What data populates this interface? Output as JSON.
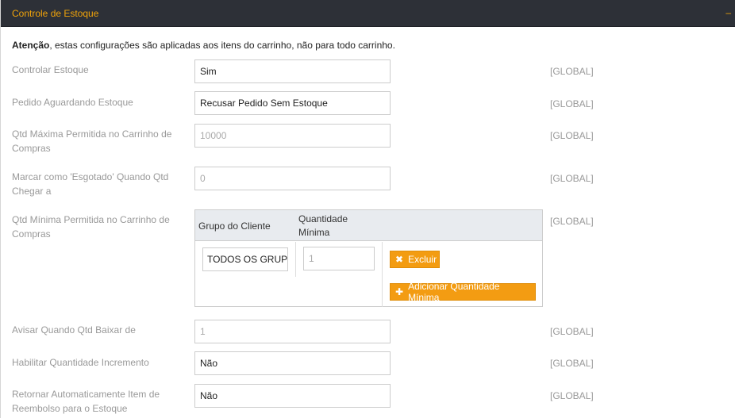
{
  "panel": {
    "title": "Controle de Estoque",
    "collapse_symbol": "–"
  },
  "notice": {
    "bold": "Atenção",
    "text": ", estas configurações são aplicadas aos itens do carrinho, não para todo carrinho."
  },
  "fields": {
    "controlar_estoque": {
      "label": "Controlar Estoque",
      "value": "Sim",
      "scope": "[GLOBAL]"
    },
    "pedido_aguardando": {
      "label": "Pedido Aguardando Estoque",
      "value": "Recusar Pedido Sem Estoque",
      "scope": "[GLOBAL]"
    },
    "qtd_maxima": {
      "label": "Qtd Máxima Permitida no Carrinho de Compras",
      "value": "10000",
      "scope": "[GLOBAL]"
    },
    "marcar_esgotado": {
      "label": "Marcar como 'Esgotado' Quando Qtd Chegar a",
      "value": "0",
      "scope": "[GLOBAL]"
    },
    "qtd_minima": {
      "label": "Qtd Mínima Permitida no Carrinho de Compras",
      "scope": "[GLOBAL]"
    },
    "avisar_qtd": {
      "label": "Avisar Quando Qtd Baixar de",
      "value": "1",
      "scope": "[GLOBAL]"
    },
    "habilitar_incremento": {
      "label": "Habilitar Quantidade Incremento",
      "value": "Não",
      "scope": "[GLOBAL]"
    },
    "retornar_reembolso": {
      "label": "Retornar Automaticamente Item de Reembolso para o Estoque",
      "value": "Não",
      "scope": "[GLOBAL]"
    }
  },
  "min_qty_table": {
    "headers": [
      "Grupo do Cliente",
      "Quantidade Mínima"
    ],
    "rows": [
      {
        "group": "TODOS OS GRUPOS",
        "qty": "1"
      }
    ],
    "delete_label": "Excluir",
    "add_label": "Adicionar Quantidade Mínima"
  }
}
